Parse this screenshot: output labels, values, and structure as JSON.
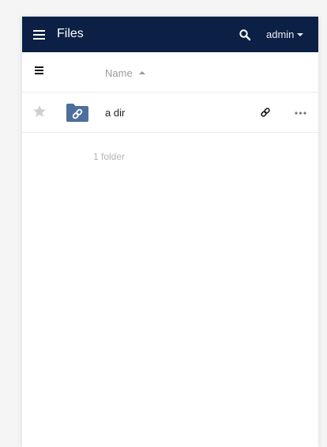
{
  "app": {
    "title": "Files",
    "user_name": "admin"
  },
  "icons": {
    "menu": "menu-icon",
    "search": "search-icon",
    "user_caret": "caret-down-icon",
    "select_all": "list-icon",
    "sort": "sort-ascending-icon",
    "favorite": "star-icon",
    "folder": "shared-link-folder-icon",
    "share": "link-icon",
    "actions": "more-actions-icon"
  },
  "file_list": {
    "columns": {
      "name": "Name"
    },
    "rows": [
      {
        "name": "a dir",
        "type": "folder",
        "favorite": false,
        "shared_by_link": true
      }
    ],
    "summary": "1 folder"
  },
  "colors": {
    "header_background": "#0b2044",
    "folder_icon": "#4e6f9b",
    "muted_text": "#9a9a9a",
    "star_inactive": "#cfcfcf"
  }
}
